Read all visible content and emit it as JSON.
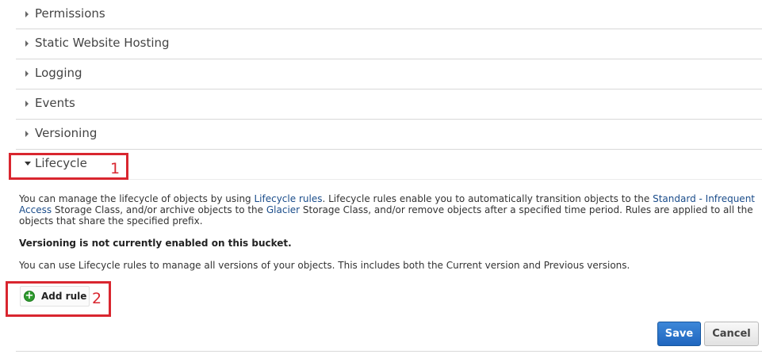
{
  "sections": [
    {
      "id": "permissions",
      "label": "Permissions"
    },
    {
      "id": "static-website-hosting",
      "label": "Static Website Hosting"
    },
    {
      "id": "logging",
      "label": "Logging"
    },
    {
      "id": "events",
      "label": "Events"
    },
    {
      "id": "versioning",
      "label": "Versioning"
    },
    {
      "id": "lifecycle",
      "label": "Lifecycle",
      "expanded": true
    }
  ],
  "lifecycle": {
    "intro": {
      "t1": "You can manage the lifecycle of objects by using ",
      "link1": "Lifecycle rules",
      "t2": ". Lifecycle rules enable you to automatically transition objects to the ",
      "link2": "Standard - Infrequent Access",
      "t3": " Storage Class, and/or archive objects to the ",
      "link3": "Glacier",
      "t4": " Storage Class, and/or remove objects after a specified time period. Rules are applied to all the objects that share the specified prefix."
    },
    "versioning_notice": "Versioning is not currently enabled on this bucket.",
    "versions_note": "You can use Lifecycle rules to manage all versions of your objects. This includes both the Current version and Previous versions.",
    "add_rule_label": "Add rule",
    "add_rule_icon": "plus-circle-icon",
    "save_label": "Save",
    "cancel_label": "Cancel"
  },
  "annotations": {
    "callout_1": "1",
    "callout_2": "2",
    "color": "#d9262f"
  },
  "colors": {
    "link": "#1a4c8a",
    "save_button": "#2a74c9",
    "add_icon": "#2e9a2e"
  }
}
